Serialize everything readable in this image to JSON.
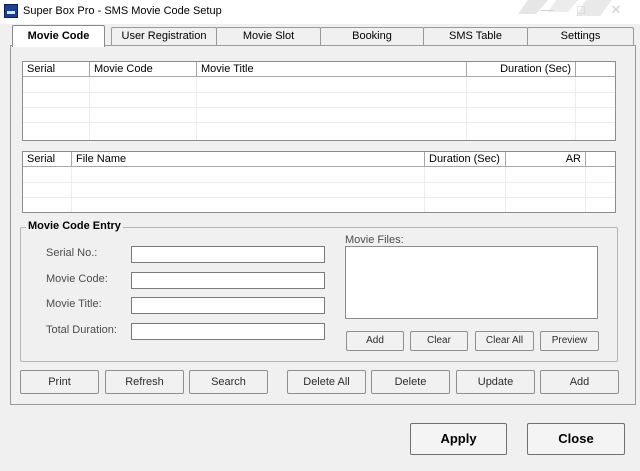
{
  "window": {
    "title": "Super Box Pro - SMS Movie Code Setup",
    "controls": {
      "minimize": "—",
      "maximize": "□",
      "close": "✕"
    }
  },
  "tabs": [
    {
      "label": "Movie Code",
      "active": true
    },
    {
      "label": "User Registration",
      "active": false
    },
    {
      "label": "Movie Slot",
      "active": false
    },
    {
      "label": "Booking",
      "active": false
    },
    {
      "label": "SMS Table",
      "active": false
    },
    {
      "label": "Settings",
      "active": false
    }
  ],
  "movie_grid": {
    "columns": [
      "Serial",
      "Movie Code",
      "Movie Title",
      "Duration (Sec)"
    ],
    "rows": []
  },
  "file_grid": {
    "columns": [
      "Serial",
      "File Name",
      "Duration (Sec)",
      "AR"
    ],
    "rows": []
  },
  "entry": {
    "legend": "Movie Code Entry",
    "serial_label": "Serial No.:",
    "serial_value": "",
    "code_label": "Movie Code:",
    "code_value": "",
    "title_label": "Movie Title:",
    "title_value": "",
    "duration_label": "Total Duration:",
    "duration_value": "",
    "files_label": "Movie Files:",
    "file_buttons": {
      "add": "Add",
      "clear": "Clear",
      "clear_all": "Clear All",
      "preview": "Preview"
    }
  },
  "actions": {
    "print": "Print",
    "refresh": "Refresh",
    "search": "Search",
    "delete_all": "Delete All",
    "delete": "Delete",
    "update": "Update",
    "add": "Add"
  },
  "footer": {
    "apply": "Apply",
    "close": "Close"
  },
  "icons": {
    "app": "app-logo-icon",
    "minimize": "minimize-icon",
    "maximize": "maximize-icon",
    "close": "close-icon"
  }
}
